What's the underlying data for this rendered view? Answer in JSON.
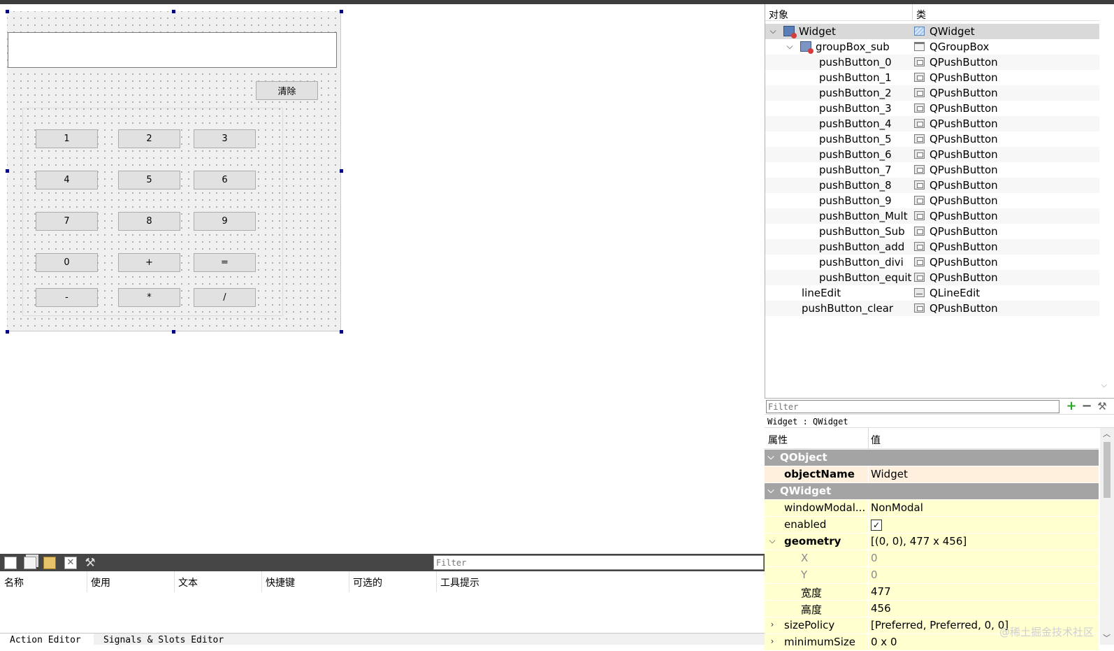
{
  "form": {
    "clear_button": "清除",
    "keypad": [
      [
        "1",
        "2",
        "3"
      ],
      [
        "4",
        "5",
        "6"
      ],
      [
        "7",
        "8",
        "9"
      ],
      [
        "0",
        "+",
        "="
      ],
      [
        "-",
        "*",
        "/"
      ]
    ]
  },
  "object_inspector": {
    "col_object": "对象",
    "col_class": "类",
    "rows": [
      {
        "name": "Widget",
        "class": "QWidget"
      },
      {
        "name": "groupBox_sub",
        "class": "QGroupBox"
      },
      {
        "name": "pushButton_0",
        "class": "QPushButton"
      },
      {
        "name": "pushButton_1",
        "class": "QPushButton"
      },
      {
        "name": "pushButton_2",
        "class": "QPushButton"
      },
      {
        "name": "pushButton_3",
        "class": "QPushButton"
      },
      {
        "name": "pushButton_4",
        "class": "QPushButton"
      },
      {
        "name": "pushButton_5",
        "class": "QPushButton"
      },
      {
        "name": "pushButton_6",
        "class": "QPushButton"
      },
      {
        "name": "pushButton_7",
        "class": "QPushButton"
      },
      {
        "name": "pushButton_8",
        "class": "QPushButton"
      },
      {
        "name": "pushButton_9",
        "class": "QPushButton"
      },
      {
        "name": "pushButton_Mult",
        "class": "QPushButton"
      },
      {
        "name": "pushButton_Sub",
        "class": "QPushButton"
      },
      {
        "name": "pushButton_add",
        "class": "QPushButton"
      },
      {
        "name": "pushButton_divi",
        "class": "QPushButton"
      },
      {
        "name": "pushButton_equit",
        "class": "QPushButton"
      },
      {
        "name": "lineEdit",
        "class": "QLineEdit"
      },
      {
        "name": "pushButton_clear",
        "class": "QPushButton"
      }
    ],
    "filter_placeholder": "Filter"
  },
  "context_label": "Widget : QWidget",
  "property_editor": {
    "col_property": "属性",
    "col_value": "值",
    "rows": [
      {
        "key": "QObject",
        "value": ""
      },
      {
        "key": "objectName",
        "value": "Widget"
      },
      {
        "key": "QWidget",
        "value": ""
      },
      {
        "key": "windowModal...",
        "value": "NonModal"
      },
      {
        "key": "enabled",
        "value": "✓"
      },
      {
        "key": "geometry",
        "value": "[(0, 0), 477 x 456]"
      },
      {
        "key": "X",
        "value": "0"
      },
      {
        "key": "Y",
        "value": "0"
      },
      {
        "key": "宽度",
        "value": "477"
      },
      {
        "key": "高度",
        "value": "456"
      },
      {
        "key": "sizePolicy",
        "value": "[Preferred, Preferred, 0, 0]"
      },
      {
        "key": "minimumSize",
        "value": "0 x 0"
      }
    ]
  },
  "action_editor": {
    "filter_placeholder": "Filter",
    "columns": [
      "名称",
      "使用",
      "文本",
      "快捷键",
      "可选的",
      "工具提示"
    ],
    "tabs": [
      "Action Editor",
      "Signals & Slots Editor"
    ]
  },
  "watermark": "@稀土掘金技术社区",
  "colors": {
    "group_header": "#a4a4a4",
    "prop_yellow": "#ffffd0",
    "prop_peach": "#fff0dd",
    "add_green": "#2aa52a"
  }
}
